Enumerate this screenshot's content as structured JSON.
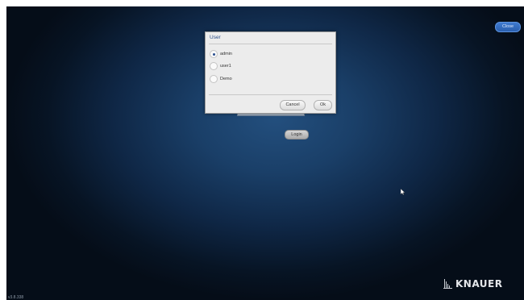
{
  "top_bar": {
    "close_label": "Close"
  },
  "login": {
    "login_label": "Login"
  },
  "user_dialog": {
    "title": "User",
    "options": [
      {
        "label": "admin",
        "selected": true
      },
      {
        "label": "user1",
        "selected": false
      },
      {
        "label": "Demo",
        "selected": false
      }
    ],
    "cancel_label": "Cancel",
    "ok_label": "Ok"
  },
  "branding": {
    "logo_text": "KNAUER"
  },
  "footer": {
    "version": "v3.8.338"
  },
  "colors": {
    "background_center": "#234f7e",
    "background_edge": "#050d18",
    "accent": "#2a5fae",
    "dialog_bg": "#ececec"
  }
}
